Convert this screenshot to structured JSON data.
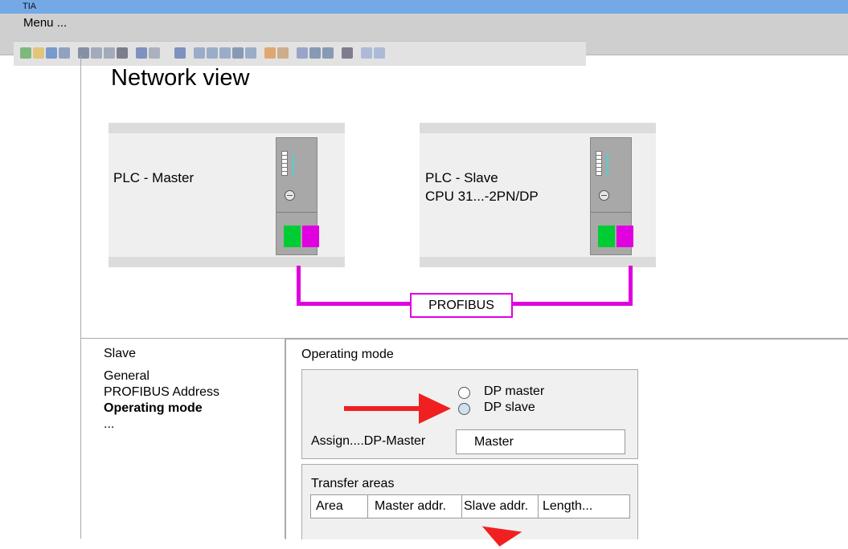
{
  "app": {
    "title": "TIA",
    "menu_label": "Menu ..."
  },
  "toolbar": {
    "icons": [
      "new-icon",
      "open-icon",
      "save-icon",
      "print-icon",
      "cut-icon",
      "copy-icon",
      "paste-icon",
      "delete-icon",
      "undo-icon",
      "redo-icon",
      "compile-icon",
      "download-icon",
      "upload-icon",
      "online-icon",
      "offline-icon",
      "monitor-icon",
      "go-online-icon",
      "go-offline-icon",
      "accessible-devices-icon",
      "cross-reference-icon",
      "split-icon",
      "close-icon",
      "window-icon",
      "layout-icon"
    ]
  },
  "network_view": {
    "heading": "Network view",
    "master": {
      "label": "PLC - Master"
    },
    "slave": {
      "label_line1": "PLC - Slave",
      "label_line2": "CPU 31...-2PN/DP"
    },
    "bus_label": "PROFIBUS"
  },
  "slave_panel": {
    "title": "Slave",
    "items": [
      "General",
      "PROFIBUS Address",
      "Operating mode",
      "..."
    ],
    "active_item": "Operating mode"
  },
  "operating_mode": {
    "title": "Operating mode",
    "option_master": "DP master",
    "option_slave": "DP slave",
    "selected": "DP slave",
    "assign_label": "Assign....DP-Master",
    "assign_value": "Master"
  },
  "transfer_areas": {
    "title": "Transfer areas",
    "columns": [
      "Area",
      "Master addr.",
      "Slave addr.",
      "Length..."
    ]
  },
  "colors": {
    "titlebar": "#74a9e6",
    "bus": "#e000e0",
    "arrow": "#f02020",
    "led_green": "#00cc33"
  }
}
